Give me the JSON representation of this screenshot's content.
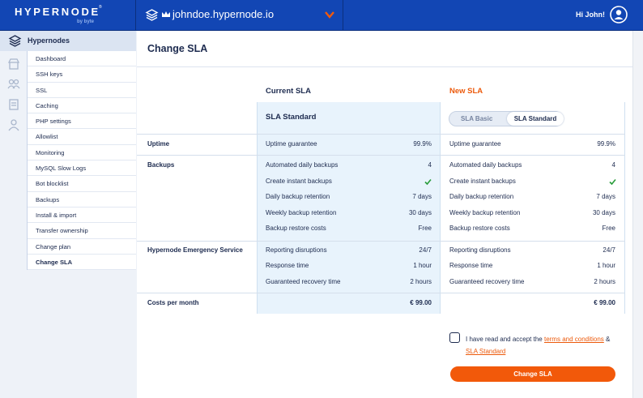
{
  "brand": {
    "logo": "HYPERNODE",
    "by": "by byte",
    "reg": "®"
  },
  "header": {
    "domain": "johndoe.hypernode.io",
    "greeting": "Hi John!"
  },
  "sidebar": {
    "title": "Hypernodes",
    "items": [
      "Dashboard",
      "SSH keys",
      "SSL",
      "Caching",
      "PHP settings",
      "Allowlist",
      "Monitoring",
      "MySQL Slow Logs",
      "Bot blocklist",
      "Backups",
      "Install & import",
      "Transfer ownership",
      "Change plan",
      "Change SLA"
    ],
    "active": "Change SLA"
  },
  "page": {
    "title": "Change SLA"
  },
  "current": {
    "heading": "Current SLA",
    "plan": "SLA Standard"
  },
  "new": {
    "heading": "New SLA",
    "options": [
      "SLA Basic",
      "SLA Standard"
    ],
    "selected": "SLA Standard"
  },
  "groups": [
    "Uptime",
    "Backups",
    "Hypernode Emergency Service",
    "Costs per month"
  ],
  "rows": [
    {
      "label": "Uptime guarantee",
      "current": "99.9%",
      "new": "99.9%"
    },
    {
      "label": "Automated daily backups",
      "current": "4",
      "new": "4"
    },
    {
      "label": "Create instant backups",
      "current": "check",
      "new": "check"
    },
    {
      "label": "Daily backup retention",
      "current": "7 days",
      "new": "7 days"
    },
    {
      "label": "Weekly backup retention",
      "current": "30 days",
      "new": "30 days"
    },
    {
      "label": "Backup restore costs",
      "current": "Free",
      "new": "Free"
    },
    {
      "label": "Reporting disruptions",
      "current": "24/7",
      "new": "24/7"
    },
    {
      "label": "Response time",
      "current": "1 hour",
      "new": "1 hour"
    },
    {
      "label": "Guaranteed recovery time",
      "current": "2 hours",
      "new": "2 hours"
    }
  ],
  "cost": {
    "current": "€ 99.00",
    "new": "€ 99.00"
  },
  "agreement": {
    "prefix": "I have read and accept the ",
    "terms": "terms and conditions",
    "amp": " & ",
    "sla": "SLA Standard"
  },
  "button": {
    "label": "Change SLA"
  },
  "colors": {
    "primary": "#1246b4",
    "accent": "#f2590a",
    "current_bg": "#e8f3fc",
    "check": "#2a9d3c"
  }
}
